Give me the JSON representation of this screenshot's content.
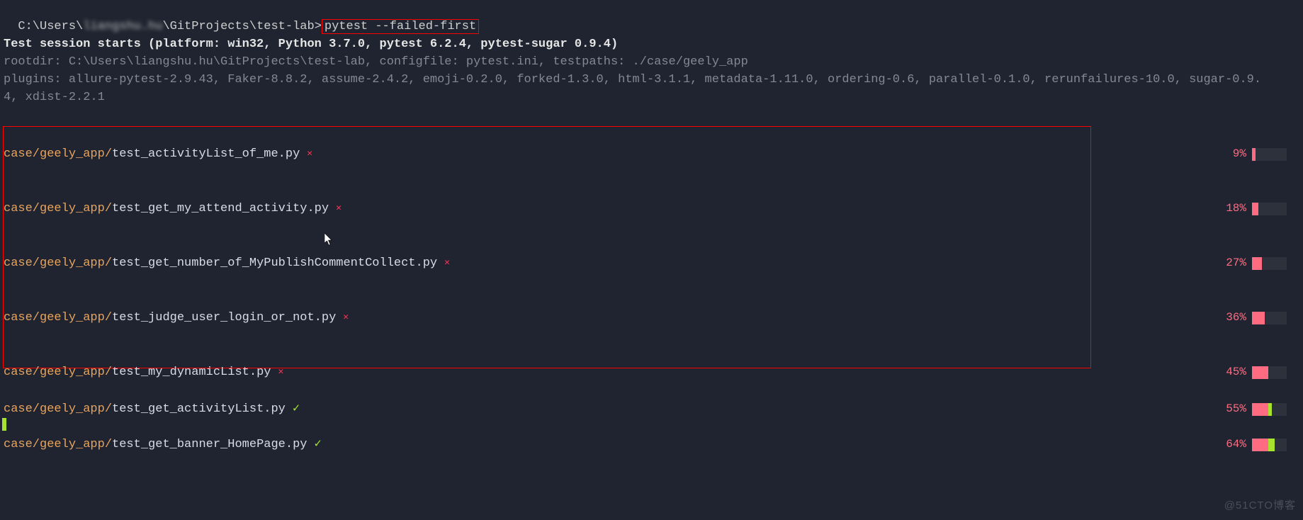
{
  "prompt": {
    "path_prefix": "C:\\Users\\",
    "path_blurred": "liangshu.hu",
    "path_suffix": "\\GitProjects\\test-lab",
    "sep": ">",
    "command": "pytest --failed-first"
  },
  "header": {
    "session": "Test session starts (platform: win32, Python 3.7.0, pytest 6.2.4, pytest-sugar 0.9.4)",
    "rootdir": "rootdir: C:\\Users\\liangshu.hu\\GitProjects\\test-lab, configfile: pytest.ini, testpaths: ./case/geely_app",
    "plugins_a": "plugins: allure-pytest-2.9.43, Faker-8.8.2, assume-2.4.2, emoji-0.2.0, forked-1.3.0, html-3.1.1, metadata-1.11.0, ordering-0.6, parallel-0.1.0, rerunfailures-10.0, sugar-0.9.",
    "plugins_b": "4, xdist-2.2.1"
  },
  "path_prefix": "case/geely_app/",
  "rows": [
    {
      "file": "test_activityList_of_me.py",
      "status": "fail",
      "pct": "9%",
      "fill_fail": 5,
      "fill_pass": 0
    },
    {
      "file": "test_get_my_attend_activity.py",
      "status": "fail",
      "pct": "18%",
      "fill_fail": 9,
      "fill_pass": 0
    },
    {
      "file": "test_get_number_of_MyPublishCommentCollect.py",
      "status": "fail",
      "pct": "27%",
      "fill_fail": 14,
      "fill_pass": 0
    },
    {
      "file": "test_judge_user_login_or_not.py",
      "status": "fail",
      "pct": "36%",
      "fill_fail": 18,
      "fill_pass": 0
    },
    {
      "file": "test_my_dynamicList.py",
      "status": "fail",
      "pct": "45%",
      "fill_fail": 23,
      "fill_pass": 0
    },
    {
      "file": "test_get_activityList.py",
      "status": "pass",
      "pct": "55%",
      "fill_fail": 23,
      "fill_pass": 5
    },
    {
      "file": "test_get_banner_HomePage.py",
      "status": "pass",
      "pct": "64%",
      "fill_fail": 23,
      "fill_pass": 9
    }
  ],
  "marks": {
    "fail": "✕",
    "pass": "✓"
  },
  "watermark": "@51CTO博客"
}
